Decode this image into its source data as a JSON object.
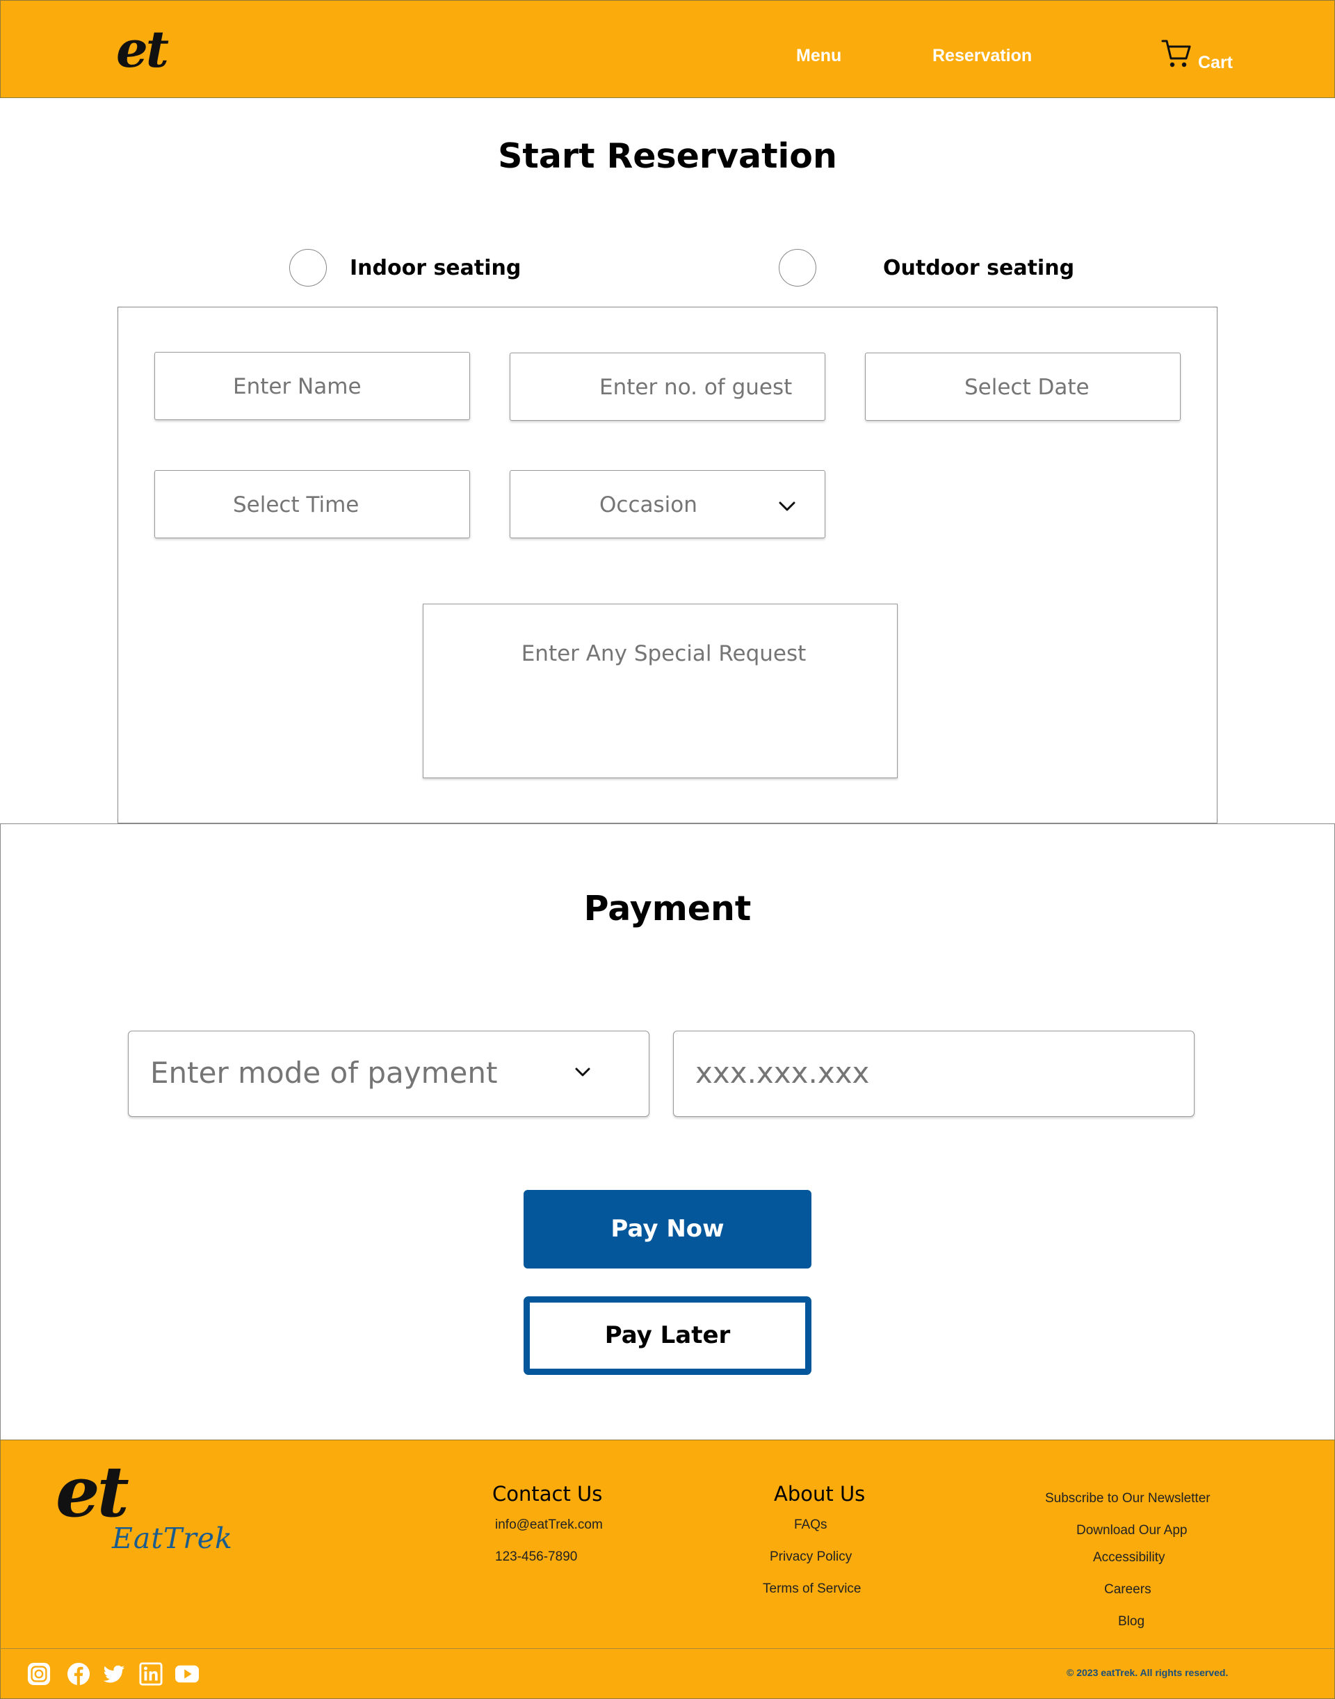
{
  "header": {
    "logo": "et",
    "nav": {
      "menu": "Menu",
      "reservation": "Reservation"
    },
    "cart_label": "Cart",
    "cart_icon": "shopping-cart-icon",
    "color": "#fbab0c"
  },
  "reservation": {
    "title": "Start Reservation",
    "seating": {
      "indoor": "Indoor seating",
      "outdoor": "Outdoor seating"
    },
    "fields": {
      "name": "Enter Name",
      "guests": "Enter no. of guest",
      "date": "Select Date",
      "time": "Select Time",
      "occasion": "Occasion",
      "special_request": "Enter Any Special Request"
    }
  },
  "payment": {
    "title": "Payment",
    "mode_placeholder": "Enter mode of payment",
    "card_placeholder": "xxx.xxx.xxx",
    "pay_now": "Pay Now",
    "pay_later": "Pay Later",
    "button_color": "#04579a"
  },
  "footer": {
    "logo": "et",
    "brand": "EatTrek",
    "contact": {
      "heading": "Contact Us",
      "email": "info@eatTrek.com",
      "phone": "123-456-7890"
    },
    "about": {
      "heading": "About Us",
      "faqs": "FAQs",
      "privacy": "Privacy Policy",
      "terms": "Terms of Service"
    },
    "more": {
      "newsletter": "Subscribe to Our Newsletter",
      "app": "Download Our App",
      "accessibility": "Accessibility",
      "careers": "Careers",
      "blog": "Blog"
    },
    "social_icons": [
      "instagram-icon",
      "facebook-icon",
      "twitter-icon",
      "linkedin-icon",
      "youtube-icon"
    ],
    "copyright": "© 2023 eatTrek. All rights reserved."
  }
}
